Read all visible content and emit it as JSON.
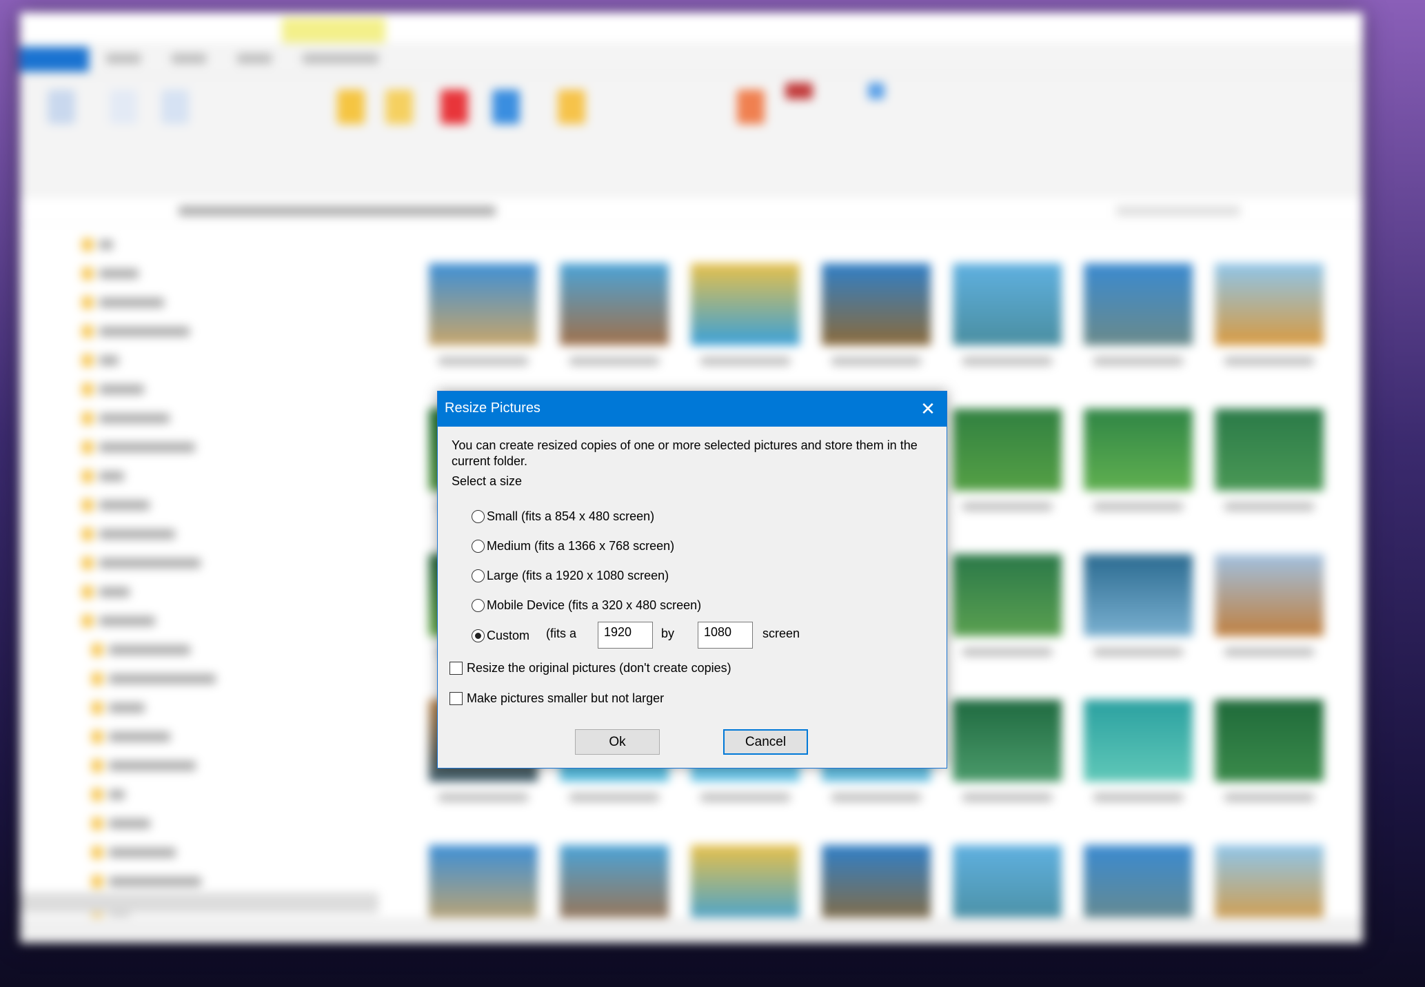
{
  "background": {
    "accent": "#0078d7",
    "manage_tab_color": "#f3f08a"
  },
  "dialog": {
    "title": "Resize Pictures",
    "close_icon": "close-icon",
    "description": "You can create resized copies of one or more selected pictures and store them in the current folder.",
    "select_label": "Select a size",
    "options": [
      {
        "label": "Small (fits a 854 x 480 screen)",
        "selected": false
      },
      {
        "label": "Medium (fits a 1366 x 768 screen)",
        "selected": false
      },
      {
        "label": "Large (fits a 1920 x 1080 screen)",
        "selected": false
      },
      {
        "label": "Mobile Device (fits a 320 x 480 screen)",
        "selected": false
      },
      {
        "label": "Custom",
        "selected": true
      }
    ],
    "custom": {
      "fits_label": "(fits a",
      "width": "1920",
      "by_label": "by",
      "height": "1080",
      "screen_label": "screen"
    },
    "checkboxes": [
      {
        "label": "Resize the original pictures (don't create copies)",
        "checked": false
      },
      {
        "label": "Make pictures smaller but not larger",
        "checked": false
      }
    ],
    "ok_label": "Ok",
    "cancel_label": "Cancel"
  }
}
